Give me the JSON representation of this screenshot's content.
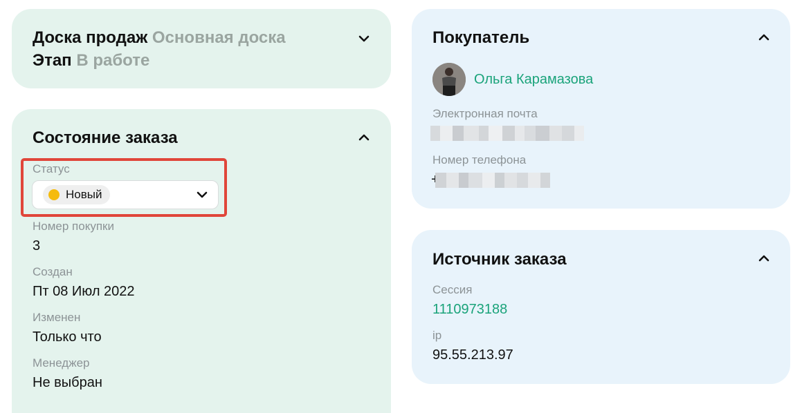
{
  "sales_board": {
    "board_label": "Доска продаж",
    "board_value": "Основная доска",
    "stage_label": "Этап",
    "stage_value": "В работе"
  },
  "order_state": {
    "title": "Состояние заказа",
    "status_label": "Статус",
    "status_value": "Новый",
    "status_color": "#f5bb0d",
    "purchase_number_label": "Номер покупки",
    "purchase_number_value": "3",
    "created_label": "Создан",
    "created_value": "Пт 08 Июл 2022",
    "modified_label": "Изменен",
    "modified_value": "Только что",
    "manager_label": "Менеджер",
    "manager_value": "Не выбран"
  },
  "buyer": {
    "title": "Покупатель",
    "name": "Ольга Карамазова",
    "email_label": "Электронная почта",
    "phone_label": "Номер телефона",
    "phone_prefix": "+"
  },
  "order_source": {
    "title": "Источник заказа",
    "session_label": "Сессия",
    "session_value": "1110973188",
    "ip_label": "ip",
    "ip_value": "95.55.213.97"
  },
  "colors": {
    "accent_green": "#1aa37a",
    "highlight_red": "#e0463a",
    "card_green": "#e4f3ed",
    "card_blue": "#e8f3fb"
  }
}
